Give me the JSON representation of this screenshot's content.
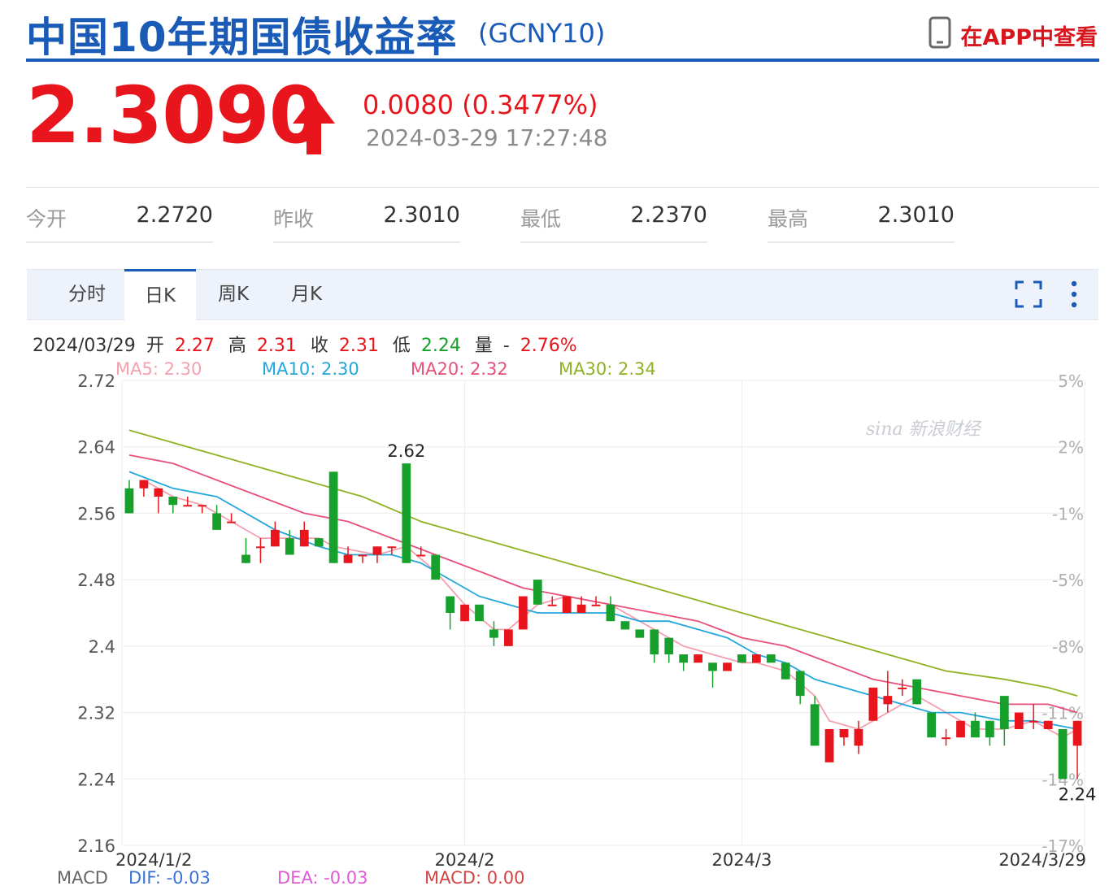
{
  "header": {
    "title": "中国10年期国债收益率",
    "symbol": "(GCNY10)",
    "app_link": "在APP中查看"
  },
  "quote": {
    "price": "2.3090",
    "direction": "up",
    "change": "0.0080 (0.3477%)",
    "time": "2024-03-29 17:27:48"
  },
  "stats": [
    {
      "label": "今开",
      "value": "2.2720"
    },
    {
      "label": "昨收",
      "value": "2.3010"
    },
    {
      "label": "最低",
      "value": "2.2370"
    },
    {
      "label": "最高",
      "value": "2.3010"
    }
  ],
  "tabs": [
    {
      "label": "分时",
      "active": false
    },
    {
      "label": "日K",
      "active": true
    },
    {
      "label": "周K",
      "active": false
    },
    {
      "label": "月K",
      "active": false
    }
  ],
  "toolbar_icons": [
    "fullscreen-icon",
    "more-vertical-icon"
  ],
  "ohlc_line": {
    "date": "2024/03/29",
    "open_label": "开",
    "open": "2.27",
    "high_label": "高",
    "high": "2.31",
    "close_label": "收",
    "close": "2.31",
    "low_label": "低",
    "low": "2.24",
    "volume_label": "量",
    "volume": "-",
    "change_pct": "2.76%"
  },
  "ma_legend": [
    {
      "label": "MA5: 2.30",
      "color": "#f4a0ae"
    },
    {
      "label": "MA10: 2.30",
      "color": "#22a7db"
    },
    {
      "label": "MA20: 2.32",
      "color": "#e8507a"
    },
    {
      "label": "MA30: 2.34",
      "color": "#8fb222"
    }
  ],
  "watermark": "sina 新浪财经",
  "macd_legend": {
    "macd_label": "MACD",
    "dif": "DIF: -0.03",
    "dea": "DEA: -0.03",
    "macd": "MACD: 0.00"
  },
  "colors": {
    "brand": "#1a5bb8",
    "up": "#e8161c",
    "down": "#18a02c",
    "grid": "#ececec",
    "dif": "#3d72d6",
    "dea": "#e05ad6",
    "macd": "#d24545"
  },
  "chart_data": {
    "type": "candlestick",
    "y_ticks": [
      "2.72",
      "2.64",
      "2.56",
      "2.48",
      "2.4",
      "2.32",
      "2.24",
      "2.16"
    ],
    "y_tick_values": [
      2.72,
      2.64,
      2.56,
      2.48,
      2.4,
      2.32,
      2.24,
      2.16
    ],
    "ylim": [
      2.16,
      2.72
    ],
    "y_right_ticks": [
      "5%",
      "2%",
      "-1%",
      "-5%",
      "-8%",
      "-11%",
      "-14%",
      "-17%"
    ],
    "x_labels": [
      "2024/1/2",
      "2024/2",
      "2024/3",
      "2024/3/29"
    ],
    "x_label_index": [
      0,
      23,
      42,
      65
    ],
    "grid": true,
    "annotations": [
      {
        "text": "2.62",
        "index": 19,
        "value": 2.62,
        "position": "above"
      },
      {
        "text": "2.24",
        "index": 65,
        "value": 2.24,
        "position": "below"
      }
    ],
    "candles": [
      {
        "o": 2.59,
        "h": 2.6,
        "l": 2.56,
        "c": 2.56
      },
      {
        "o": 2.59,
        "h": 2.6,
        "l": 2.58,
        "c": 2.6
      },
      {
        "o": 2.58,
        "h": 2.59,
        "l": 2.56,
        "c": 2.59
      },
      {
        "o": 2.58,
        "h": 2.58,
        "l": 2.56,
        "c": 2.57
      },
      {
        "o": 2.57,
        "h": 2.58,
        "l": 2.57,
        "c": 2.57
      },
      {
        "o": 2.57,
        "h": 2.57,
        "l": 2.56,
        "c": 2.57
      },
      {
        "o": 2.56,
        "h": 2.57,
        "l": 2.54,
        "c": 2.54
      },
      {
        "o": 2.55,
        "h": 2.56,
        "l": 2.55,
        "c": 2.55
      },
      {
        "o": 2.51,
        "h": 2.53,
        "l": 2.5,
        "c": 2.5
      },
      {
        "o": 2.52,
        "h": 2.53,
        "l": 2.5,
        "c": 2.52
      },
      {
        "o": 2.52,
        "h": 2.55,
        "l": 2.52,
        "c": 2.54
      },
      {
        "o": 2.53,
        "h": 2.54,
        "l": 2.51,
        "c": 2.51
      },
      {
        "o": 2.52,
        "h": 2.55,
        "l": 2.52,
        "c": 2.54
      },
      {
        "o": 2.53,
        "h": 2.53,
        "l": 2.52,
        "c": 2.52
      },
      {
        "o": 2.61,
        "h": 2.61,
        "l": 2.5,
        "c": 2.5
      },
      {
        "o": 2.5,
        "h": 2.52,
        "l": 2.5,
        "c": 2.51
      },
      {
        "o": 2.51,
        "h": 2.51,
        "l": 2.5,
        "c": 2.51
      },
      {
        "o": 2.51,
        "h": 2.52,
        "l": 2.5,
        "c": 2.52
      },
      {
        "o": 2.52,
        "h": 2.52,
        "l": 2.51,
        "c": 2.52
      },
      {
        "o": 2.62,
        "h": 2.62,
        "l": 2.5,
        "c": 2.5
      },
      {
        "o": 2.51,
        "h": 2.52,
        "l": 2.51,
        "c": 2.51
      },
      {
        "o": 2.51,
        "h": 2.51,
        "l": 2.48,
        "c": 2.48
      },
      {
        "o": 2.46,
        "h": 2.46,
        "l": 2.42,
        "c": 2.44
      },
      {
        "o": 2.43,
        "h": 2.45,
        "l": 2.43,
        "c": 2.45
      },
      {
        "o": 2.45,
        "h": 2.45,
        "l": 2.43,
        "c": 2.43
      },
      {
        "o": 2.42,
        "h": 2.43,
        "l": 2.4,
        "c": 2.41
      },
      {
        "o": 2.4,
        "h": 2.42,
        "l": 2.4,
        "c": 2.42
      },
      {
        "o": 2.42,
        "h": 2.46,
        "l": 2.42,
        "c": 2.46
      },
      {
        "o": 2.48,
        "h": 2.48,
        "l": 2.45,
        "c": 2.45
      },
      {
        "o": 2.45,
        "h": 2.46,
        "l": 2.45,
        "c": 2.45
      },
      {
        "o": 2.44,
        "h": 2.46,
        "l": 2.44,
        "c": 2.46
      },
      {
        "o": 2.44,
        "h": 2.46,
        "l": 2.44,
        "c": 2.45
      },
      {
        "o": 2.45,
        "h": 2.46,
        "l": 2.45,
        "c": 2.45
      },
      {
        "o": 2.45,
        "h": 2.46,
        "l": 2.43,
        "c": 2.43
      },
      {
        "o": 2.43,
        "h": 2.43,
        "l": 2.42,
        "c": 2.42
      },
      {
        "o": 2.42,
        "h": 2.42,
        "l": 2.41,
        "c": 2.41
      },
      {
        "o": 2.42,
        "h": 2.42,
        "l": 2.38,
        "c": 2.39
      },
      {
        "o": 2.41,
        "h": 2.41,
        "l": 2.38,
        "c": 2.39
      },
      {
        "o": 2.39,
        "h": 2.39,
        "l": 2.37,
        "c": 2.38
      },
      {
        "o": 2.38,
        "h": 2.39,
        "l": 2.38,
        "c": 2.39
      },
      {
        "o": 2.38,
        "h": 2.38,
        "l": 2.35,
        "c": 2.37
      },
      {
        "o": 2.37,
        "h": 2.38,
        "l": 2.37,
        "c": 2.38
      },
      {
        "o": 2.39,
        "h": 2.39,
        "l": 2.38,
        "c": 2.38
      },
      {
        "o": 2.38,
        "h": 2.39,
        "l": 2.38,
        "c": 2.39
      },
      {
        "o": 2.39,
        "h": 2.39,
        "l": 2.38,
        "c": 2.38
      },
      {
        "o": 2.38,
        "h": 2.38,
        "l": 2.36,
        "c": 2.36
      },
      {
        "o": 2.37,
        "h": 2.37,
        "l": 2.33,
        "c": 2.34
      },
      {
        "o": 2.33,
        "h": 2.34,
        "l": 2.28,
        "c": 2.28
      },
      {
        "o": 2.26,
        "h": 2.3,
        "l": 2.26,
        "c": 2.3
      },
      {
        "o": 2.29,
        "h": 2.3,
        "l": 2.28,
        "c": 2.3
      },
      {
        "o": 2.28,
        "h": 2.31,
        "l": 2.27,
        "c": 2.3
      },
      {
        "o": 2.31,
        "h": 2.35,
        "l": 2.31,
        "c": 2.35
      },
      {
        "o": 2.33,
        "h": 2.37,
        "l": 2.32,
        "c": 2.34
      },
      {
        "o": 2.35,
        "h": 2.36,
        "l": 2.34,
        "c": 2.35
      },
      {
        "o": 2.36,
        "h": 2.36,
        "l": 2.33,
        "c": 2.33
      },
      {
        "o": 2.32,
        "h": 2.32,
        "l": 2.29,
        "c": 2.29
      },
      {
        "o": 2.29,
        "h": 2.3,
        "l": 2.28,
        "c": 2.29
      },
      {
        "o": 2.29,
        "h": 2.31,
        "l": 2.29,
        "c": 2.31
      },
      {
        "o": 2.31,
        "h": 2.32,
        "l": 2.29,
        "c": 2.29
      },
      {
        "o": 2.31,
        "h": 2.31,
        "l": 2.28,
        "c": 2.29
      },
      {
        "o": 2.34,
        "h": 2.34,
        "l": 2.28,
        "c": 2.3
      },
      {
        "o": 2.3,
        "h": 2.32,
        "l": 2.3,
        "c": 2.32
      },
      {
        "o": 2.31,
        "h": 2.33,
        "l": 2.3,
        "c": 2.31
      },
      {
        "o": 2.3,
        "h": 2.31,
        "l": 2.3,
        "c": 2.31
      },
      {
        "o": 2.3,
        "h": 2.3,
        "l": 2.24,
        "c": 2.24
      },
      {
        "o": 2.28,
        "h": 2.31,
        "l": 2.24,
        "c": 2.31
      }
    ],
    "ma_series": [
      {
        "name": "MA5",
        "color": "#f4a0ae",
        "points": [
          [
            1,
            2.6
          ],
          [
            3,
            2.58
          ],
          [
            5,
            2.57
          ],
          [
            7,
            2.55
          ],
          [
            9,
            2.53
          ],
          [
            11,
            2.53
          ],
          [
            13,
            2.53
          ],
          [
            14,
            2.52
          ],
          [
            17,
            2.51
          ],
          [
            19,
            2.52
          ],
          [
            21,
            2.49
          ],
          [
            23,
            2.45
          ],
          [
            25,
            2.42
          ],
          [
            26,
            2.42
          ],
          [
            28,
            2.45
          ],
          [
            30,
            2.46
          ],
          [
            33,
            2.45
          ],
          [
            35,
            2.43
          ],
          [
            38,
            2.4
          ],
          [
            40,
            2.39
          ],
          [
            42,
            2.38
          ],
          [
            43,
            2.38
          ],
          [
            45,
            2.37
          ],
          [
            47,
            2.34
          ],
          [
            48,
            2.31
          ],
          [
            50,
            2.3
          ],
          [
            52,
            2.32
          ],
          [
            54,
            2.34
          ],
          [
            56,
            2.32
          ],
          [
            58,
            2.3
          ],
          [
            60,
            2.3
          ],
          [
            62,
            2.31
          ],
          [
            64,
            2.29
          ],
          [
            65,
            2.3
          ]
        ]
      },
      {
        "name": "MA10",
        "color": "#22a7db",
        "points": [
          [
            0,
            2.61
          ],
          [
            3,
            2.59
          ],
          [
            6,
            2.58
          ],
          [
            8,
            2.56
          ],
          [
            10,
            2.54
          ],
          [
            13,
            2.52
          ],
          [
            15,
            2.51
          ],
          [
            18,
            2.51
          ],
          [
            20,
            2.5
          ],
          [
            22,
            2.48
          ],
          [
            24,
            2.46
          ],
          [
            26,
            2.45
          ],
          [
            28,
            2.44
          ],
          [
            30,
            2.44
          ],
          [
            33,
            2.44
          ],
          [
            35,
            2.43
          ],
          [
            37,
            2.43
          ],
          [
            39,
            2.42
          ],
          [
            41,
            2.41
          ],
          [
            43,
            2.39
          ],
          [
            45,
            2.38
          ],
          [
            47,
            2.36
          ],
          [
            49,
            2.35
          ],
          [
            51,
            2.34
          ],
          [
            53,
            2.33
          ],
          [
            55,
            2.32
          ],
          [
            57,
            2.32
          ],
          [
            60,
            2.31
          ],
          [
            62,
            2.31
          ],
          [
            65,
            2.3
          ]
        ]
      },
      {
        "name": "MA20",
        "color": "#e8507a",
        "points": [
          [
            0,
            2.63
          ],
          [
            3,
            2.62
          ],
          [
            6,
            2.6
          ],
          [
            9,
            2.58
          ],
          [
            12,
            2.56
          ],
          [
            15,
            2.55
          ],
          [
            18,
            2.53
          ],
          [
            21,
            2.51
          ],
          [
            24,
            2.49
          ],
          [
            27,
            2.47
          ],
          [
            30,
            2.46
          ],
          [
            33,
            2.45
          ],
          [
            36,
            2.44
          ],
          [
            39,
            2.43
          ],
          [
            42,
            2.41
          ],
          [
            45,
            2.4
          ],
          [
            48,
            2.38
          ],
          [
            51,
            2.36
          ],
          [
            54,
            2.35
          ],
          [
            57,
            2.34
          ],
          [
            60,
            2.33
          ],
          [
            63,
            2.33
          ],
          [
            65,
            2.32
          ]
        ]
      },
      {
        "name": "MA30",
        "color": "#8fb222",
        "points": [
          [
            0,
            2.66
          ],
          [
            4,
            2.64
          ],
          [
            8,
            2.62
          ],
          [
            12,
            2.6
          ],
          [
            16,
            2.58
          ],
          [
            20,
            2.55
          ],
          [
            24,
            2.53
          ],
          [
            28,
            2.51
          ],
          [
            32,
            2.49
          ],
          [
            36,
            2.47
          ],
          [
            40,
            2.45
          ],
          [
            44,
            2.43
          ],
          [
            48,
            2.41
          ],
          [
            52,
            2.39
          ],
          [
            56,
            2.37
          ],
          [
            60,
            2.36
          ],
          [
            63,
            2.35
          ],
          [
            65,
            2.34
          ]
        ]
      }
    ]
  }
}
